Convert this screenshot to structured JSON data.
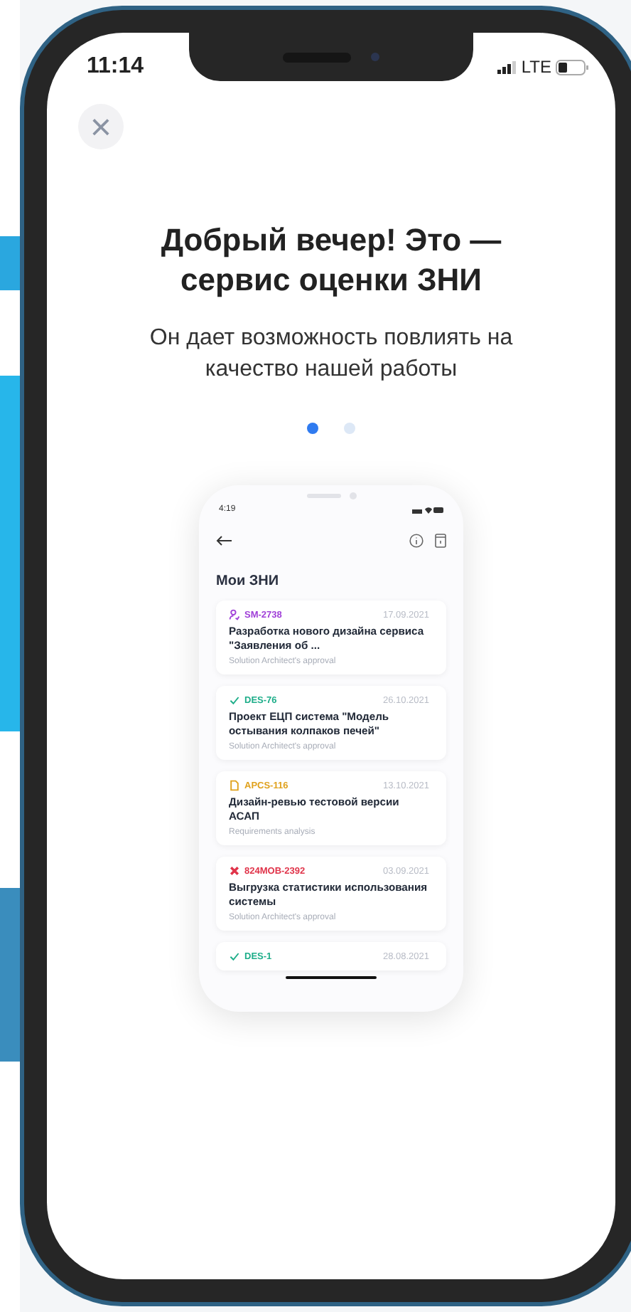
{
  "status_bar": {
    "time": "11:14",
    "network": "LTE"
  },
  "close_button": {
    "label": "×"
  },
  "title": "Добрый вечер! Это — сервис оценки ЗНИ",
  "subtitle": "Он дает возможность повлиять на качество нашей работы",
  "pager": [
    {
      "selected": true
    },
    {
      "selected": false
    }
  ],
  "preview": {
    "status_bar": {
      "time": "4:19"
    },
    "title": "Мои ЗНИ",
    "cards": [
      {
        "kind": "user",
        "color": "#a040d8",
        "code": "SM-2738",
        "date": "17.09.2021",
        "title": "Разработка нового дизайна сервиса \"Заявления об ...",
        "stage": "Solution Architect's approval"
      },
      {
        "kind": "check",
        "color": "#1fae8a",
        "code": "DES-76",
        "date": "26.10.2021",
        "title": "Проект ЕЦП система \"Модель остывания колпаков печей\"",
        "stage": "Solution Architect's approval"
      },
      {
        "kind": "doc",
        "color": "#e0a21e",
        "code": "APCS-116",
        "date": "13.10.2021",
        "title": "Дизайн-ревью тестовой версии АСАП",
        "stage": "Requirements analysis"
      },
      {
        "kind": "cross",
        "color": "#e0344a",
        "code": "824MOB-2392",
        "date": "03.09.2021",
        "title": "Выгрузка статистики использования системы",
        "stage": "Solution Architect's approval"
      },
      {
        "kind": "check",
        "color": "#1fae8a",
        "code": "DES-1",
        "date": "28.08.2021"
      }
    ]
  }
}
